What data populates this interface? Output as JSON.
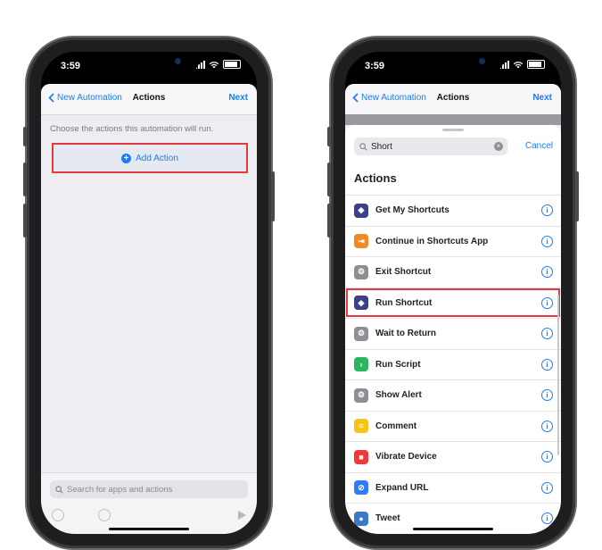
{
  "left_phone": {
    "status": {
      "time": "3:59"
    },
    "nav": {
      "back": "New Automation",
      "title": "Actions",
      "next": "Next"
    },
    "hint": "Choose the actions this automation will run.",
    "add_action": "Add Action",
    "search_placeholder": "Search for apps and actions"
  },
  "right_phone": {
    "status": {
      "time": "3:59"
    },
    "nav": {
      "back": "New Automation",
      "title": "Actions",
      "next": "Next"
    },
    "search": {
      "value": "Short",
      "cancel": "Cancel"
    },
    "section_title": "Actions",
    "items": [
      {
        "label": "Get My Shortcuts",
        "color": "#3b3f8c",
        "icon": "shortcuts-icon"
      },
      {
        "label": "Continue in Shortcuts App",
        "color": "#f08a24",
        "icon": "continue-icon"
      },
      {
        "label": "Exit Shortcut",
        "color": "#8e8e93",
        "icon": "gear-icon"
      },
      {
        "label": "Run Shortcut",
        "color": "#3b3f8c",
        "icon": "shortcuts-icon",
        "highlighted": true
      },
      {
        "label": "Wait to Return",
        "color": "#8e8e93",
        "icon": "gear-icon"
      },
      {
        "label": "Run Script",
        "color": "#2bb55f",
        "icon": "script-icon"
      },
      {
        "label": "Show Alert",
        "color": "#8e8e93",
        "icon": "gear-icon"
      },
      {
        "label": "Comment",
        "color": "#f6c419",
        "icon": "comment-icon"
      },
      {
        "label": "Vibrate Device",
        "color": "#f2383b",
        "icon": "vibrate-icon"
      },
      {
        "label": "Expand URL",
        "color": "#2f7df6",
        "icon": "link-icon"
      },
      {
        "label": "Tweet",
        "color": "#3a78c9",
        "icon": "tweetbot-icon"
      }
    ]
  }
}
